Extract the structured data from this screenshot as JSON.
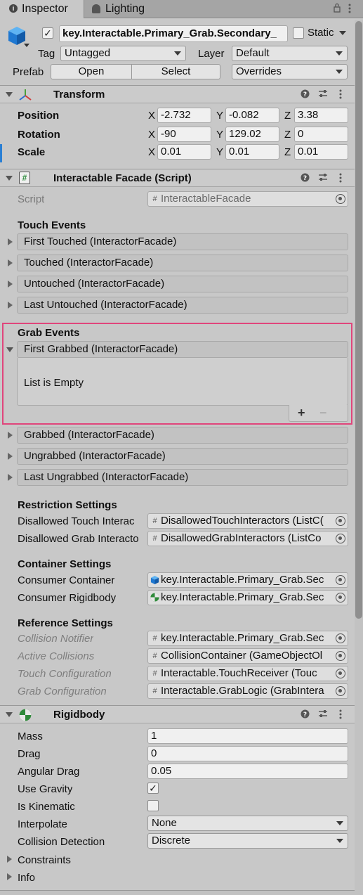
{
  "tabs": [
    {
      "label": "Inspector",
      "icon": "info-icon",
      "active": true
    },
    {
      "label": "Lighting",
      "icon": "lighting-icon",
      "active": false
    }
  ],
  "gameobject": {
    "name": "key.Interactable.Primary_Grab.Secondary_",
    "static_label": "Static",
    "tag_label": "Tag",
    "tag_value": "Untagged",
    "layer_label": "Layer",
    "layer_value": "Default",
    "prefab_label": "Prefab",
    "open_label": "Open",
    "select_label": "Select",
    "overrides_label": "Overrides"
  },
  "transform": {
    "title": "Transform",
    "rows": [
      {
        "label": "Position",
        "x": "-2.732",
        "y": "-0.082",
        "z": "3.38"
      },
      {
        "label": "Rotation",
        "x": "-90",
        "y": "129.02",
        "z": "0"
      },
      {
        "label": "Scale",
        "x": "0.01",
        "y": "0.01",
        "z": "0.01"
      }
    ],
    "axis": {
      "x": "X",
      "y": "Y",
      "z": "Z"
    }
  },
  "facade": {
    "title": "Interactable Facade (Script)",
    "script_label": "Script",
    "script_value": "InteractableFacade",
    "touch_events_label": "Touch Events",
    "touch_events": [
      "First Touched (InteractorFacade)",
      "Touched (InteractorFacade)",
      "Untouched (InteractorFacade)",
      "Last Untouched (InteractorFacade)"
    ],
    "grab_events_label": "Grab Events",
    "first_grabbed": "First Grabbed (InteractorFacade)",
    "list_empty": "List is Empty",
    "add_symbol": "+",
    "remove_symbol": "−",
    "grab_events": [
      "Grabbed (InteractorFacade)",
      "Ungrabbed (InteractorFacade)",
      "Last Ungrabbed (InteractorFacade)"
    ],
    "restriction_label": "Restriction Settings",
    "restriction": [
      {
        "label": "Disallowed Touch Interac",
        "value": "DisallowedTouchInteractors (ListC("
      },
      {
        "label": "Disallowed Grab Interacto",
        "value": "DisallowedGrabInteractors (ListCo"
      }
    ],
    "container_label": "Container Settings",
    "container": [
      {
        "label": "Consumer Container",
        "value": "key.Interactable.Primary_Grab.Sec"
      },
      {
        "label": "Consumer Rigidbody",
        "value": "key.Interactable.Primary_Grab.Sec"
      }
    ],
    "reference_label": "Reference Settings",
    "reference": [
      {
        "label": "Collision Notifier",
        "value": "key.Interactable.Primary_Grab.Sec"
      },
      {
        "label": "Active Collisions",
        "value": "CollisionContainer (GameObjectOl"
      },
      {
        "label": "Touch Configuration",
        "value": "Interactable.TouchReceiver (Touc"
      },
      {
        "label": "Grab Configuration",
        "value": "Interactable.GrabLogic (GrabIntera"
      }
    ]
  },
  "rigidbody": {
    "title": "Rigidbody",
    "mass_label": "Mass",
    "mass": "1",
    "drag_label": "Drag",
    "drag": "0",
    "angular_drag_label": "Angular Drag",
    "angular_drag": "0.05",
    "use_gravity_label": "Use Gravity",
    "use_gravity_mark": "✓",
    "is_kinematic_label": "Is Kinematic",
    "interpolate_label": "Interpolate",
    "interpolate": "None",
    "collision_label": "Collision Detection",
    "collision": "Discrete",
    "constraints_label": "Constraints",
    "info_label": "Info"
  },
  "colors": {
    "highlight": "#e0457b",
    "accent_blue": "#2a7fd4"
  }
}
